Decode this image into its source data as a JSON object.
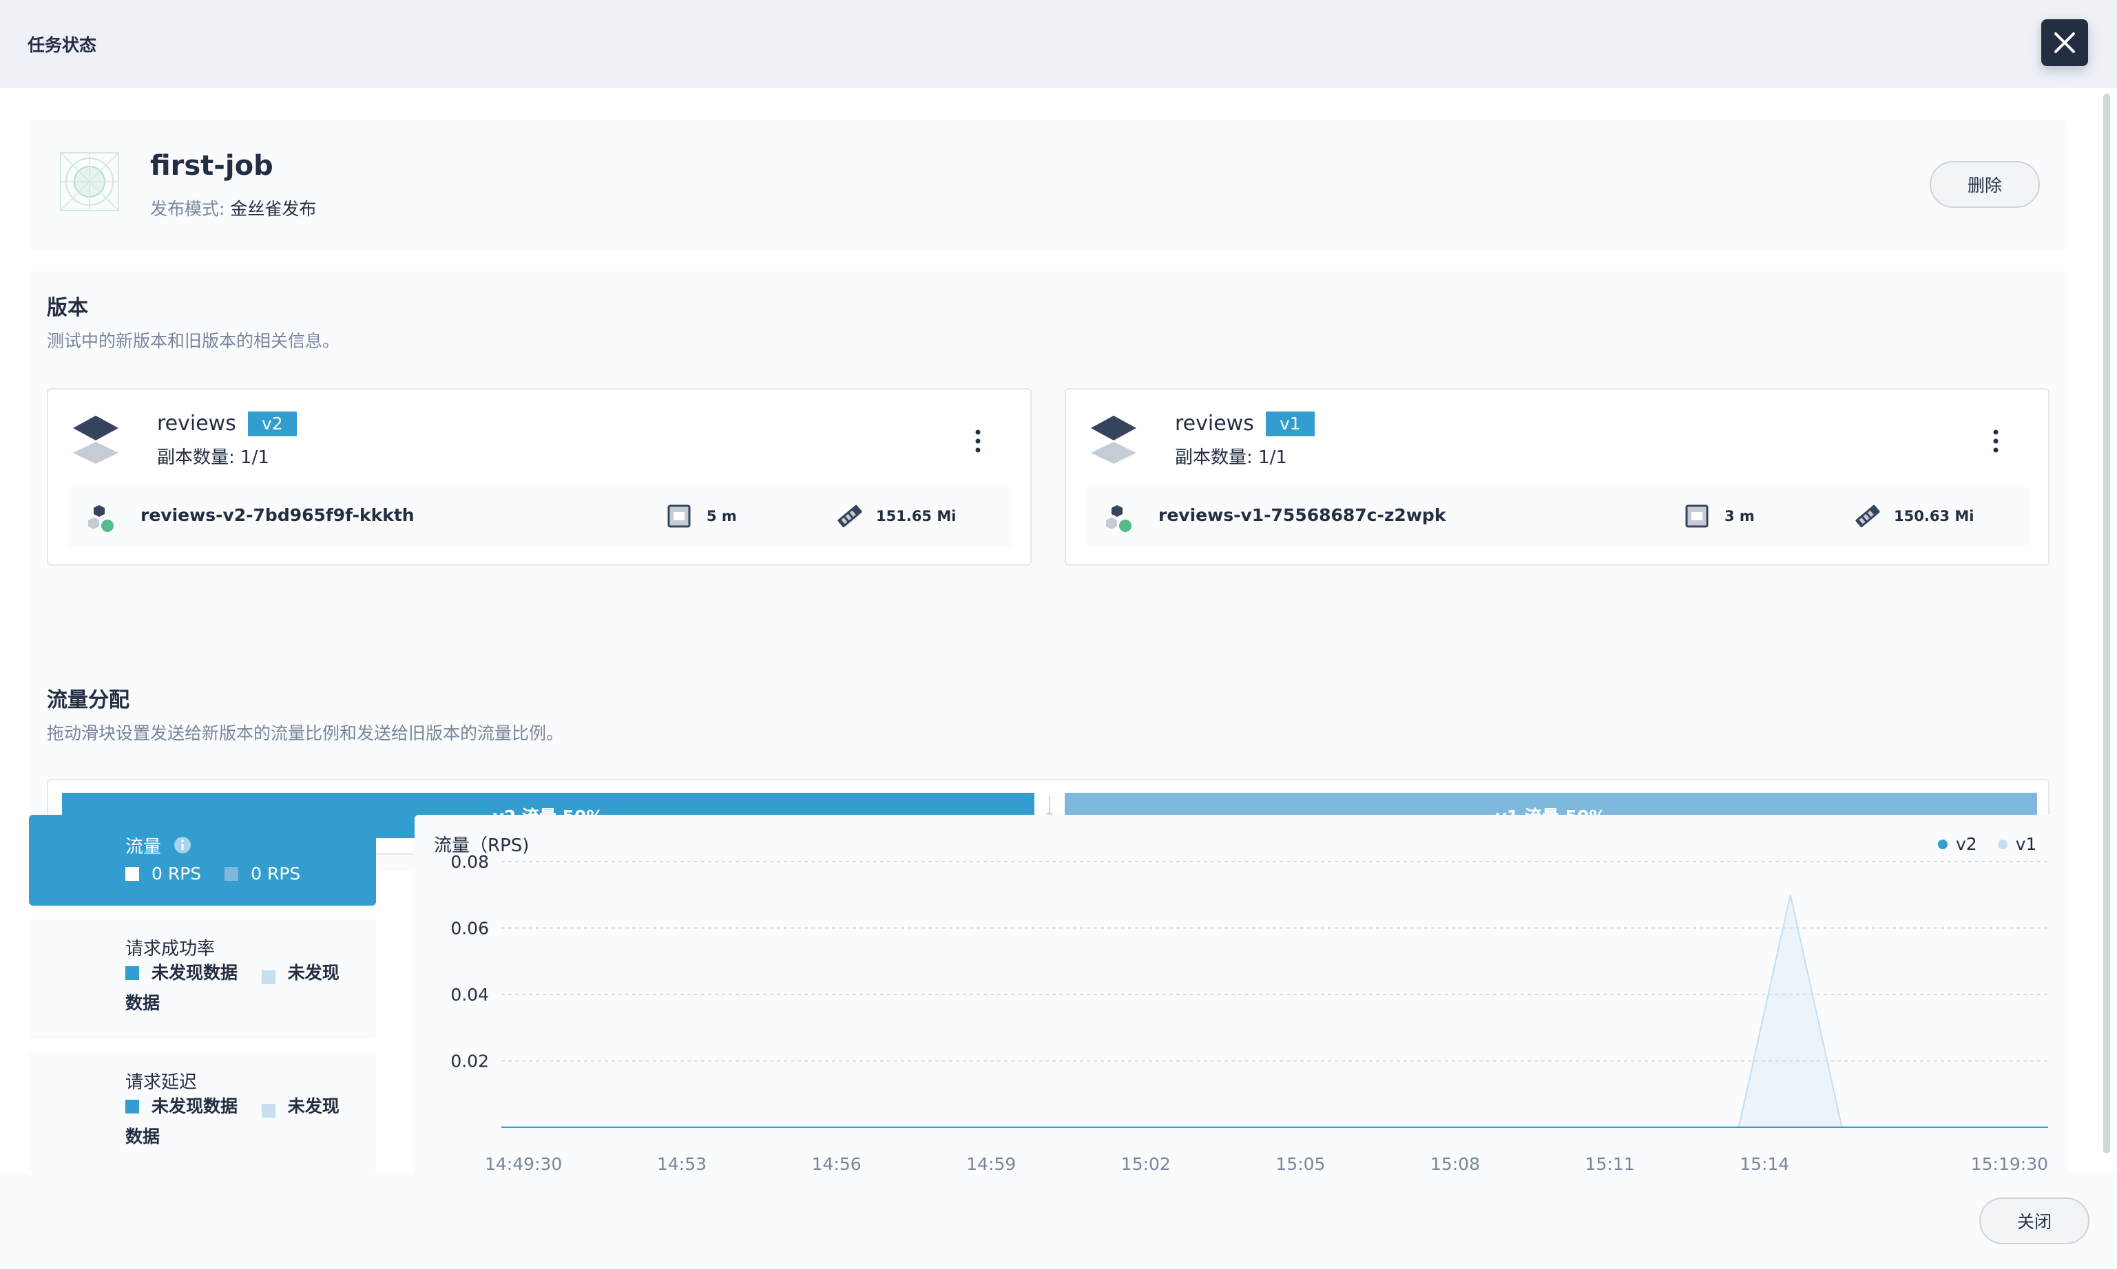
{
  "modal": {
    "title": "任务状态",
    "close_label": "关闭"
  },
  "job": {
    "name": "first-job",
    "mode_label": "发布模式:",
    "mode_value": "金丝雀发布",
    "delete_label": "删除"
  },
  "versions_section": {
    "title": "版本",
    "description": "测试中的新版本和旧版本的相关信息。",
    "cards": [
      {
        "name": "reviews",
        "tag": "v2",
        "replicas": "副本数量: 1/1",
        "pod": {
          "name": "reviews-v2-7bd965f9f-kkkth",
          "cpu": "5 m",
          "memory": "151.65 Mi"
        }
      },
      {
        "name": "reviews",
        "tag": "v1",
        "replicas": "副本数量: 1/1",
        "pod": {
          "name": "reviews-v1-75568687c-z2wpk",
          "cpu": "3 m",
          "memory": "150.63 Mi"
        }
      }
    ]
  },
  "traffic_section": {
    "title": "流量分配",
    "description": "拖动滑块设置发送给新版本的流量比例和发送给旧版本的流量比例。",
    "v2_label": "v2 流量 50%",
    "v1_label": "v1 流量 50%",
    "v2_percent": 50,
    "v1_percent": 50
  },
  "metric_tabs": [
    {
      "title": "流量",
      "v2_value": "0 RPS",
      "v1_value": "0 RPS",
      "active": true
    },
    {
      "title": "请求成功率",
      "line1": "未发现数据",
      "line2a": "未发现",
      "line2b": "数据",
      "active": false
    },
    {
      "title": "请求延迟",
      "line1": "未发现数据",
      "line2a": "未发现",
      "line2b": "数据",
      "active": false
    }
  ],
  "colors": {
    "accent": "#329dce",
    "accent_light": "#7eb8dc",
    "series_v1": "#c7deef",
    "text": "#242e42",
    "muted": "#79879c"
  },
  "chart_data": {
    "type": "area",
    "title": "流量（RPS)",
    "ylim": [
      0,
      0.08
    ],
    "y_ticks": [
      "0.08",
      "0.06",
      "0.04",
      "0.02"
    ],
    "x_tick_labels": [
      "14:49:30",
      "14:53",
      "14:56",
      "14:59",
      "15:02",
      "15:05",
      "15:08",
      "15:11",
      "15:14",
      "15:19:30"
    ],
    "legend_position": "top-right",
    "grid": true,
    "series": [
      {
        "name": "v2",
        "color": "#329dce",
        "points": [
          [
            "14:49:30",
            0
          ],
          [
            "15:13:30",
            0
          ],
          [
            "15:14:30",
            0
          ],
          [
            "15:19:30",
            0
          ]
        ]
      },
      {
        "name": "v1",
        "color": "#c7deef",
        "points": [
          [
            "14:49:30",
            0
          ],
          [
            "15:13:30",
            0
          ],
          [
            "15:14:30",
            0.07
          ],
          [
            "15:15:30",
            0
          ],
          [
            "15:19:30",
            0
          ]
        ]
      }
    ]
  }
}
